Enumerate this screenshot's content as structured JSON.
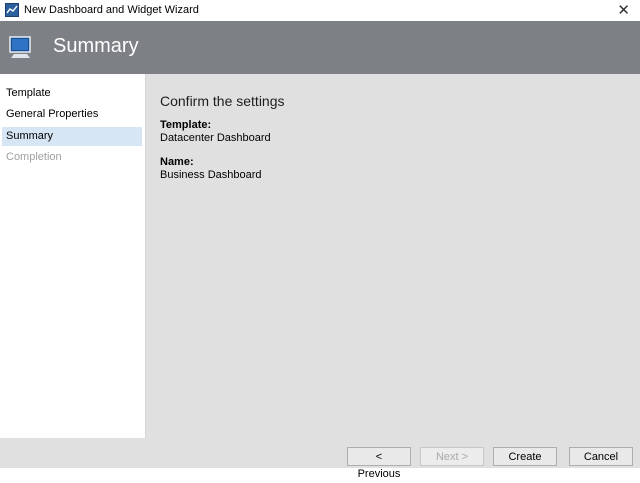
{
  "window": {
    "title": "New Dashboard and Widget Wizard",
    "close_glyph": "✕"
  },
  "banner": {
    "heading": "Summary",
    "icon": "monitor-icon"
  },
  "nav": {
    "items": [
      {
        "label": "Template",
        "state": "normal"
      },
      {
        "label": "General Properties",
        "state": "normal"
      },
      {
        "label": "Summary",
        "state": "selected"
      },
      {
        "label": "Completion",
        "state": "disabled"
      }
    ]
  },
  "main": {
    "section_title": "Confirm the settings",
    "fields": [
      {
        "label": "Template:",
        "value": "Datacenter Dashboard"
      },
      {
        "label": "Name:",
        "value": "Business Dashboard"
      }
    ]
  },
  "footer": {
    "previous_label": "< Previous",
    "next_label": "Next >",
    "create_label": "Create",
    "cancel_label": "Cancel"
  },
  "colors": {
    "banner": "#7d8186",
    "content_bg": "#e0e0e0",
    "nav_selected": "#d6e6f4"
  }
}
